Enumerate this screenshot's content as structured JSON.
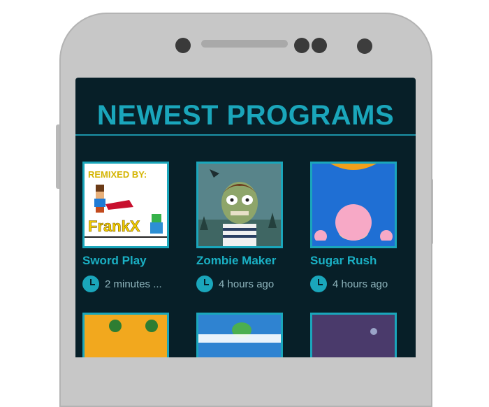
{
  "header": {
    "title": "NEWEST PROGRAMS"
  },
  "colors": {
    "accent": "#1aa6bb",
    "screen_bg": "#071f28",
    "phone_body": "#c7c7c7"
  },
  "programs": [
    {
      "title": "Sword Play",
      "time": "2 minutes ...",
      "thumb_text_top": "REMIXED BY:",
      "thumb_text_bottom": "FrankX"
    },
    {
      "title": "Zombie Maker",
      "time": "4 hours ago"
    },
    {
      "title": "Sugar Rush",
      "time": "4 hours ago"
    }
  ],
  "icons": {
    "time": "clock-icon"
  }
}
